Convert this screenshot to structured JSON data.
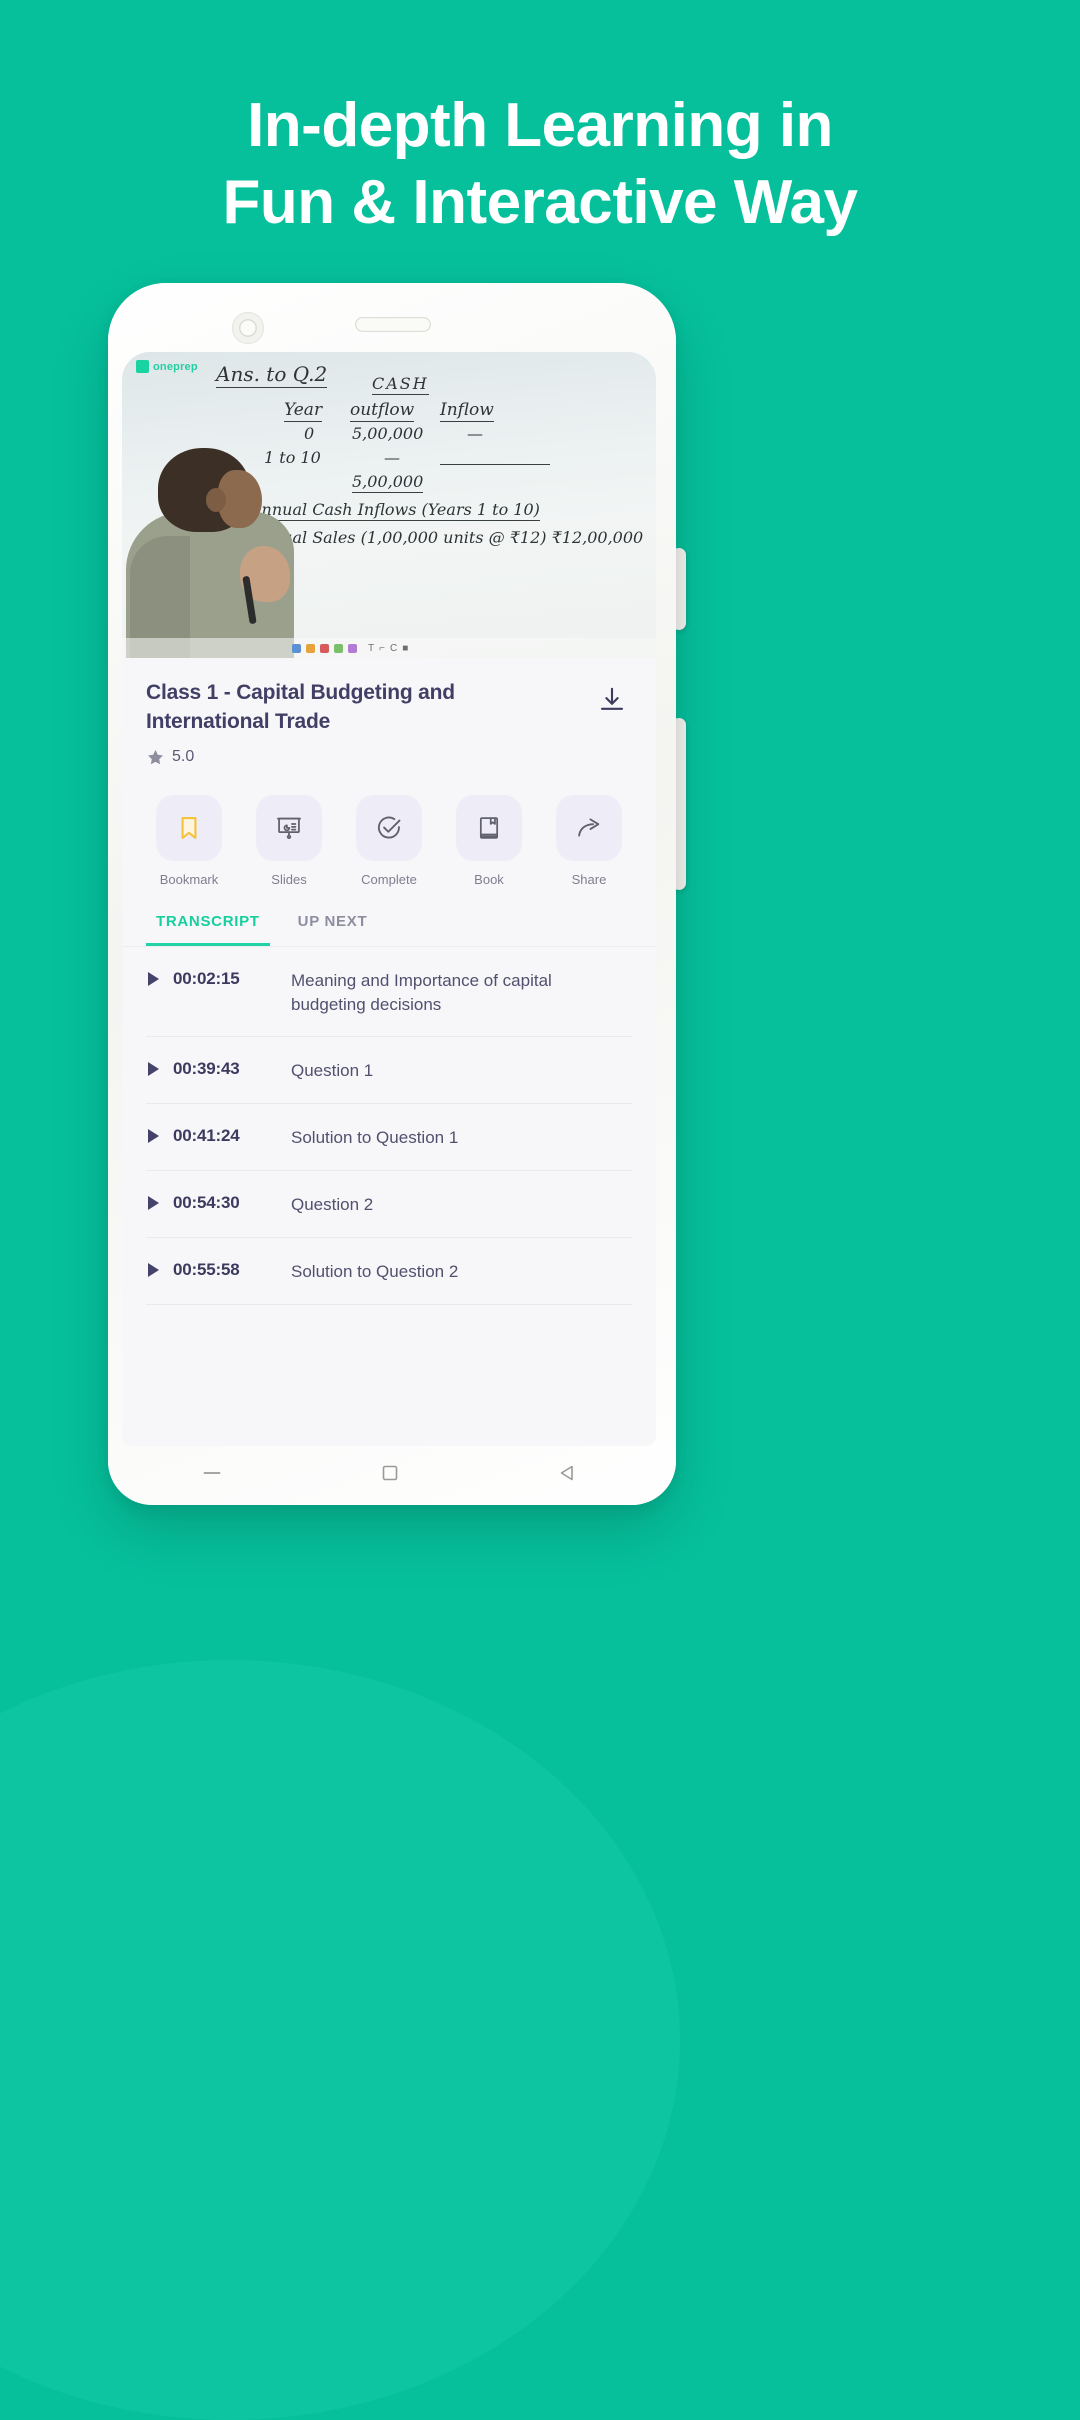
{
  "headline": {
    "line1": "In-depth Learning in",
    "line2": "Fun & Interactive Way"
  },
  "colors": {
    "background": "#06c09c",
    "accent": "#22d3a4",
    "title_text": "#423f66",
    "bookmark": "#f7c948",
    "tile": "#eeecf6"
  },
  "video": {
    "watermark": "oneprep",
    "board": {
      "heading": "Ans. to Q.2",
      "cash_header": "CASH",
      "col_year": "Year",
      "col_outflow": "outflow",
      "col_inflow": "Inflow",
      "row1_year": "0",
      "row1_outflow": "5,00,000",
      "row1_inflow": "—",
      "row2_year": "1 to 10",
      "row2_outflow": "—",
      "total_outflow": "5,00,000",
      "line_inflows": "Annual Cash Inflows (Years 1 to 10)",
      "line_sales": "Annual Sales (1,00,000 units @ ₹12)  ₹12,00,000",
      "line_partial": "("
    }
  },
  "card": {
    "title": "Class 1 - Capital Budgeting and International Trade",
    "rating": "5.0",
    "star_icon": "star-icon",
    "download_icon": "download-icon"
  },
  "actions": [
    {
      "label": "Bookmark",
      "icon": "bookmark-icon"
    },
    {
      "label": "Slides",
      "icon": "slides-icon"
    },
    {
      "label": "Complete",
      "icon": "check-circle-icon"
    },
    {
      "label": "Book",
      "icon": "book-icon"
    },
    {
      "label": "Share",
      "icon": "share-icon"
    }
  ],
  "tabs": [
    {
      "label": "TRANSCRIPT",
      "active": true
    },
    {
      "label": "UP NEXT",
      "active": false
    }
  ],
  "transcript": [
    {
      "time": "00:02:15",
      "label": "Meaning and Importance of capital budgeting decisions"
    },
    {
      "time": "00:39:43",
      "label": "Question 1"
    },
    {
      "time": "00:41:24",
      "label": "Solution to Question 1"
    },
    {
      "time": "00:54:30",
      "label": "Question 2"
    },
    {
      "time": "00:55:58",
      "label": "Solution to Question 2"
    }
  ],
  "nav": [
    {
      "icon": "recents-icon"
    },
    {
      "icon": "home-icon"
    },
    {
      "icon": "back-icon"
    }
  ]
}
